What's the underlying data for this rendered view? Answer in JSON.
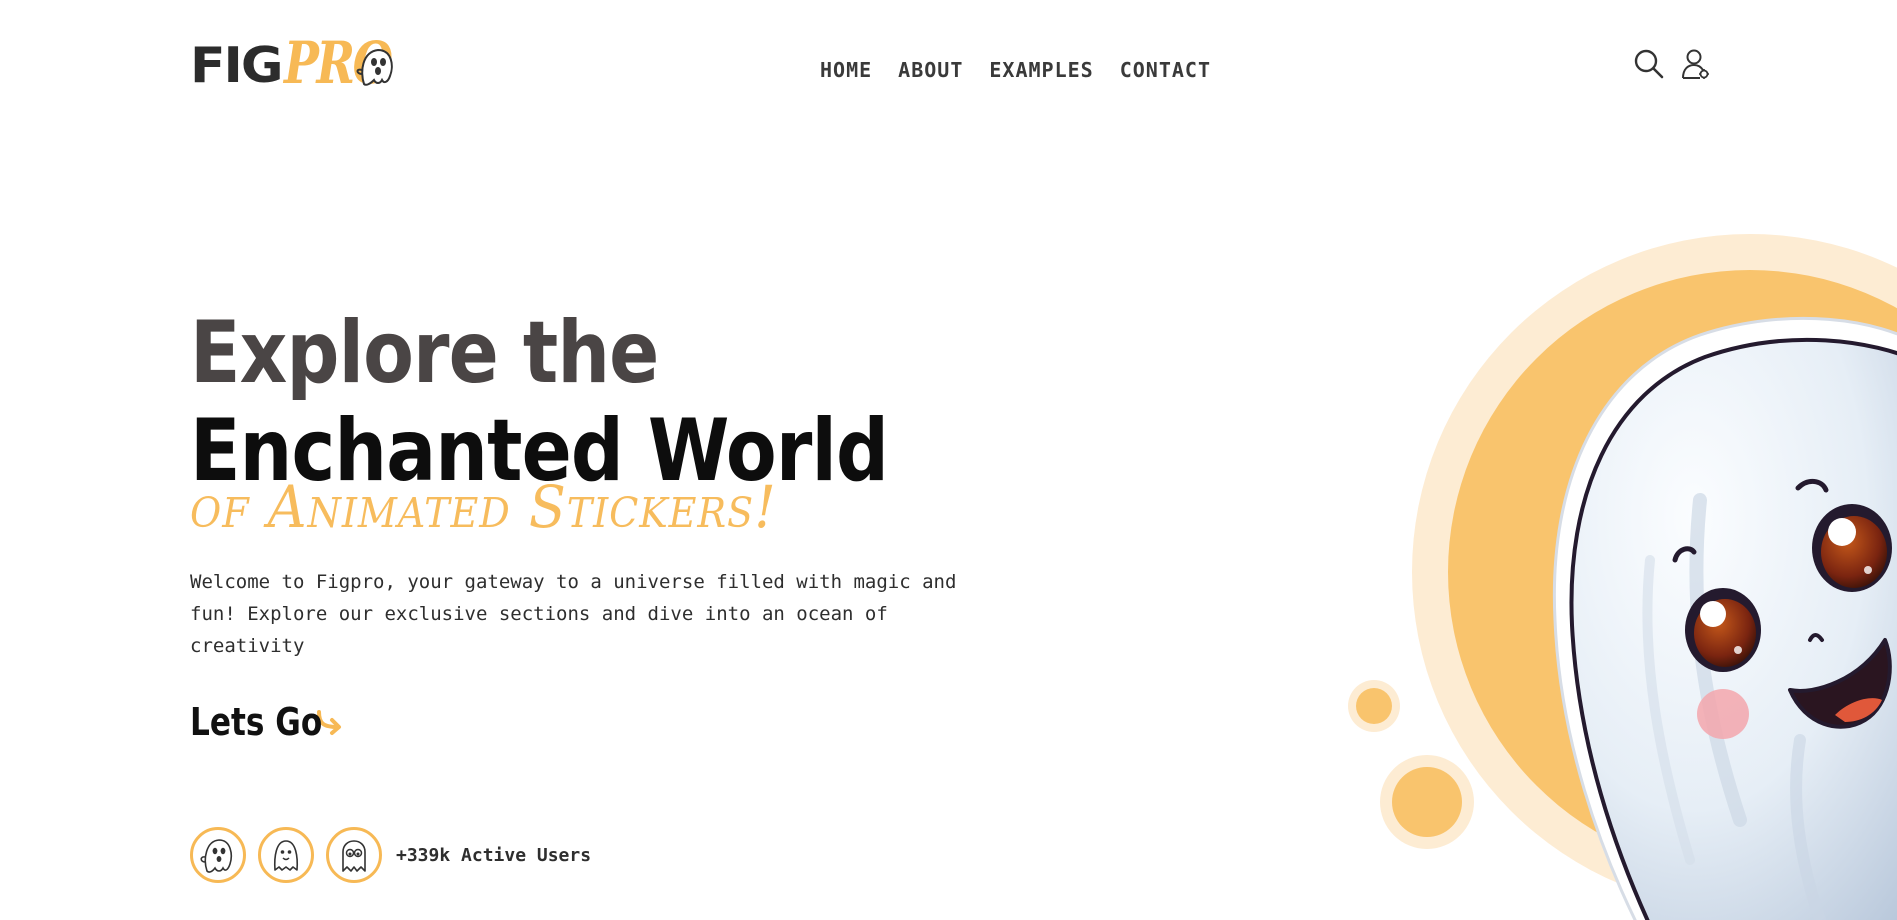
{
  "header": {
    "logo": {
      "primary": "FIG",
      "accent": "PRO"
    },
    "nav": [
      {
        "label": "HOME"
      },
      {
        "label": "ABOUT"
      },
      {
        "label": "EXAMPLES"
      },
      {
        "label": "CONTACT"
      }
    ],
    "icons": {
      "search": "search-icon",
      "account": "user-icon"
    }
  },
  "hero": {
    "title_line1": "Explore the",
    "title_line2": "Enchanted World",
    "subtitle": "of Animated Stickers!",
    "description": "Welcome to Figpro, your gateway to a universe filled with magic and fun! Explore our exclusive sections and dive into an ocean of creativity",
    "cta_label": "Lets Go",
    "cta_icon": "curved-arrow-icon",
    "users_text": "+339k Active Users",
    "avatars": [
      "ghost-avatar-1",
      "ghost-avatar-2",
      "ghost-avatar-3"
    ]
  },
  "colors": {
    "accent": "#f7b955",
    "accent_light": "#fdecd3",
    "text_dark": "#2b2b2b"
  }
}
